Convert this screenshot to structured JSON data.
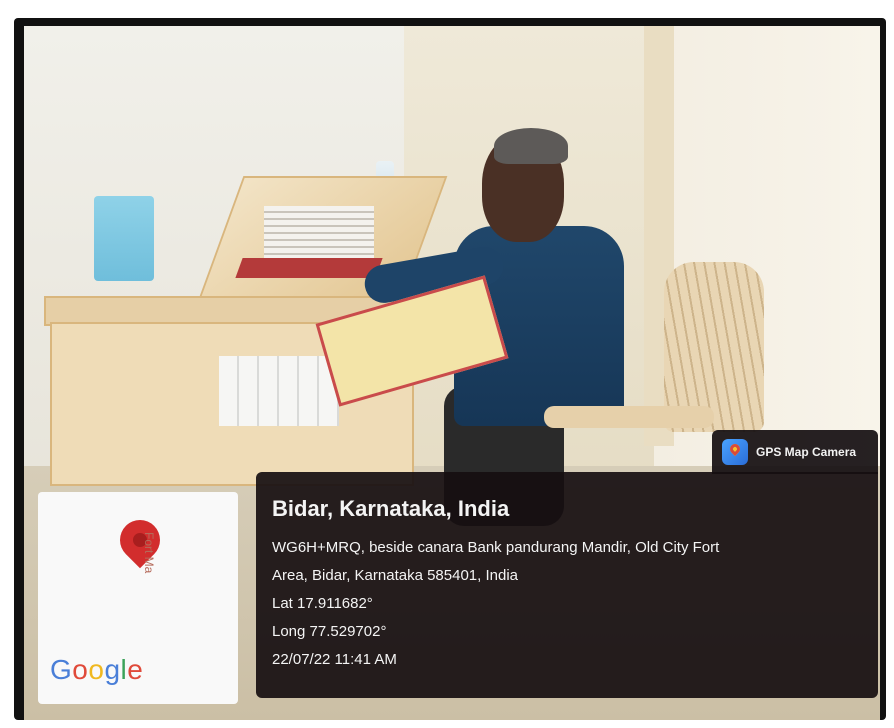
{
  "gps_badge": {
    "label": "GPS Map Camera",
    "icon": "gps-map-camera-app-icon"
  },
  "location": {
    "title": "Bidar, Karnataka, India",
    "address_line1": "WG6H+MRQ, beside canara Bank pandurang Mandir, Old City Fort",
    "address_line2": "Area, Bidar, Karnataka 585401, India",
    "lat": "Lat 17.911682°",
    "long": "Long 77.529702°",
    "datetime": "22/07/22 11:41 AM"
  },
  "map": {
    "place_label": "Fort Ma",
    "brand_letters": [
      "G",
      "o",
      "o",
      "g",
      "l",
      "e"
    ],
    "pin_icon": "map-pin-icon"
  }
}
